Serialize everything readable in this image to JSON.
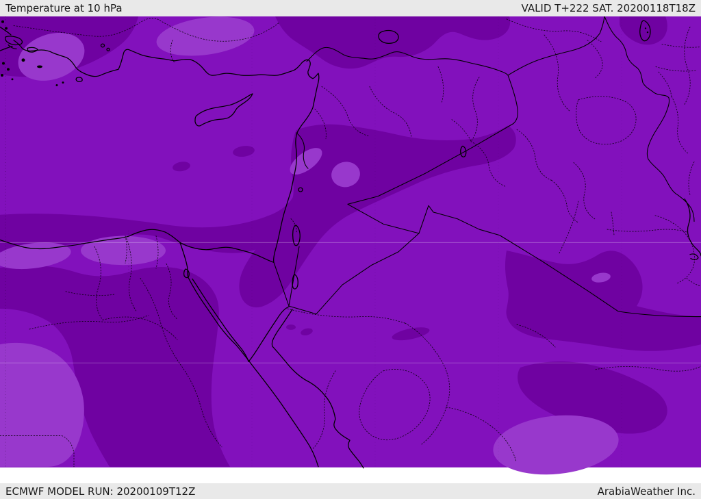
{
  "header": {
    "title": "Temperature at 10 hPa",
    "valid_time": "VALID T+222 SAT. 20200118T18Z"
  },
  "footer": {
    "model_run": "ECMWF MODEL RUN: 20200109T12Z",
    "credit": "ArabiaWeather Inc."
  },
  "colors": {
    "base": "#8211bc",
    "dark": "#6f02a1",
    "light": "#9838cc",
    "graticule": "rgba(255,255,255,0.28)",
    "line": "#000000",
    "bar_bg": "#e9e9e9",
    "bar_text": "#1a1a1a"
  }
}
